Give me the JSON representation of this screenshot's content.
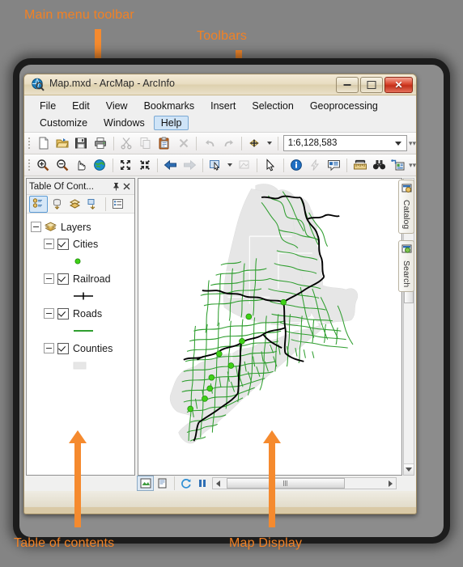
{
  "annotations": [
    {
      "id": "main-menu-toolbar",
      "text": "Main menu toolbar"
    },
    {
      "id": "toolbars",
      "text": "Toolbars"
    },
    {
      "id": "table-of-contents",
      "text": "Table of contents"
    },
    {
      "id": "map-display",
      "text": "Map Display"
    }
  ],
  "window": {
    "title": "Map.mxd - ArcMap - ArcInfo",
    "app_icon": "arcmap-globe-icon",
    "buttons": {
      "minimize": "minimize-button",
      "restore": "restore-button",
      "close": "close-button",
      "close_glyph": "✕"
    }
  },
  "menu": {
    "row1": [
      {
        "label": "File",
        "accel": "F"
      },
      {
        "label": "Edit",
        "accel": "E"
      },
      {
        "label": "View",
        "accel": "V"
      },
      {
        "label": "Bookmarks",
        "accel": "B"
      },
      {
        "label": "Insert",
        "accel": "I"
      },
      {
        "label": "Selection",
        "accel": "S"
      },
      {
        "label": "Geoprocessing",
        "accel": "G"
      }
    ],
    "row2": [
      {
        "label": "Customize",
        "accel": "C",
        "highlighted": false
      },
      {
        "label": "Windows",
        "accel": "W",
        "highlighted": false
      },
      {
        "label": "Help",
        "accel": "H",
        "highlighted": true
      }
    ]
  },
  "standard_toolbar": {
    "items": [
      {
        "name": "new-document-icon",
        "tooltip": "New",
        "enabled": true
      },
      {
        "name": "open-folder-icon",
        "tooltip": "Open",
        "enabled": true
      },
      {
        "name": "save-icon",
        "tooltip": "Save",
        "enabled": true
      },
      {
        "name": "print-icon",
        "tooltip": "Print",
        "enabled": true
      },
      {
        "name": "cut-scissors-icon",
        "tooltip": "Cut",
        "enabled": false
      },
      {
        "name": "copy-icon",
        "tooltip": "Copy",
        "enabled": false
      },
      {
        "name": "paste-clipboard-icon",
        "tooltip": "Paste",
        "enabled": true
      },
      {
        "name": "delete-x-icon",
        "tooltip": "Delete",
        "enabled": false
      },
      {
        "name": "undo-arrow-icon",
        "tooltip": "Undo",
        "enabled": false
      },
      {
        "name": "redo-arrow-icon",
        "tooltip": "Redo",
        "enabled": false
      },
      {
        "name": "add-data-icon",
        "tooltip": "Add Data",
        "enabled": true
      }
    ],
    "scale": "1:6,128,583",
    "scale_label": "Map Scale"
  },
  "tools_toolbar": {
    "items": [
      {
        "name": "zoom-in-icon",
        "tooltip": "Zoom In"
      },
      {
        "name": "zoom-out-icon",
        "tooltip": "Zoom Out"
      },
      {
        "name": "pan-hand-icon",
        "tooltip": "Pan"
      },
      {
        "name": "full-extent-globe-icon",
        "tooltip": "Full Extent"
      },
      {
        "name": "fixed-zoom-in-icon",
        "tooltip": "Fixed Zoom In"
      },
      {
        "name": "fixed-zoom-out-icon",
        "tooltip": "Fixed Zoom Out"
      },
      {
        "name": "go-back-extent-icon",
        "tooltip": "Go Back To Previous Extent"
      },
      {
        "name": "go-next-extent-icon",
        "tooltip": "Go To Next Extent"
      },
      {
        "name": "select-features-icon",
        "tooltip": "Select Features"
      },
      {
        "name": "clear-selection-icon",
        "tooltip": "Clear Selected Features"
      },
      {
        "name": "select-elements-arrow-icon",
        "tooltip": "Select Elements"
      },
      {
        "name": "identify-info-icon",
        "tooltip": "Identify"
      },
      {
        "name": "hyperlink-lightning-icon",
        "tooltip": "Hyperlink"
      },
      {
        "name": "html-popup-icon",
        "tooltip": "HTML Popup"
      },
      {
        "name": "measure-ruler-icon",
        "tooltip": "Measure"
      },
      {
        "name": "find-binoculars-icon",
        "tooltip": "Find"
      },
      {
        "name": "go-to-xy-icon",
        "tooltip": "Go To XY"
      }
    ]
  },
  "table_of_contents": {
    "title": "Table Of Cont...",
    "pin_icon": "pin-icon",
    "close_icon": "close-icon",
    "toolbar": [
      {
        "name": "list-by-drawing-order-icon",
        "label": "List By Drawing Order",
        "active": true
      },
      {
        "name": "list-by-source-icon",
        "label": "List By Source",
        "active": false
      },
      {
        "name": "list-by-visibility-icon",
        "label": "List By Visibility",
        "active": false
      },
      {
        "name": "list-by-selection-icon",
        "label": "List By Selection",
        "active": false
      },
      {
        "name": "toc-options-icon",
        "label": "Options",
        "active": false
      }
    ],
    "root": {
      "label": "Layers",
      "icon": "data-frame-icon",
      "expanded": true
    },
    "layers": [
      {
        "label": "Cities",
        "checked": true,
        "expanded": true,
        "symbol": "point",
        "color": "#3fd117"
      },
      {
        "label": "Railroad",
        "checked": true,
        "expanded": true,
        "symbol": "railroad",
        "color": "#000000"
      },
      {
        "label": "Roads",
        "checked": true,
        "expanded": true,
        "symbol": "line",
        "color": "#2f9e2f"
      },
      {
        "label": "Counties",
        "checked": true,
        "expanded": true,
        "symbol": "polygon",
        "color": "#e6e6e6"
      }
    ]
  },
  "map_display": {
    "title": "Map Display",
    "background": "#ffffff",
    "layers_drawn": [
      "Counties",
      "Roads",
      "Railroad",
      "Cities"
    ],
    "status_buttons": [
      {
        "name": "data-view-button",
        "label": "Data View",
        "active": true
      },
      {
        "name": "layout-view-button",
        "label": "Layout View",
        "active": false
      },
      {
        "name": "refresh-view-button",
        "label": "Refresh View",
        "active": false
      },
      {
        "name": "pause-drawing-button",
        "label": "Pause Drawing",
        "active": false
      }
    ]
  },
  "dock_tabs": [
    {
      "label": "Catalog",
      "icon": "catalog-icon"
    },
    {
      "label": "Search",
      "icon": "search-icon"
    }
  ],
  "colors": {
    "annotation": "#F28124",
    "desktop": "#848484",
    "roads": "#2f9e2f",
    "railroad": "#000000",
    "cities": "#3fd117",
    "counties": "#e6e6e6",
    "highlight": "#cfe4f7"
  }
}
